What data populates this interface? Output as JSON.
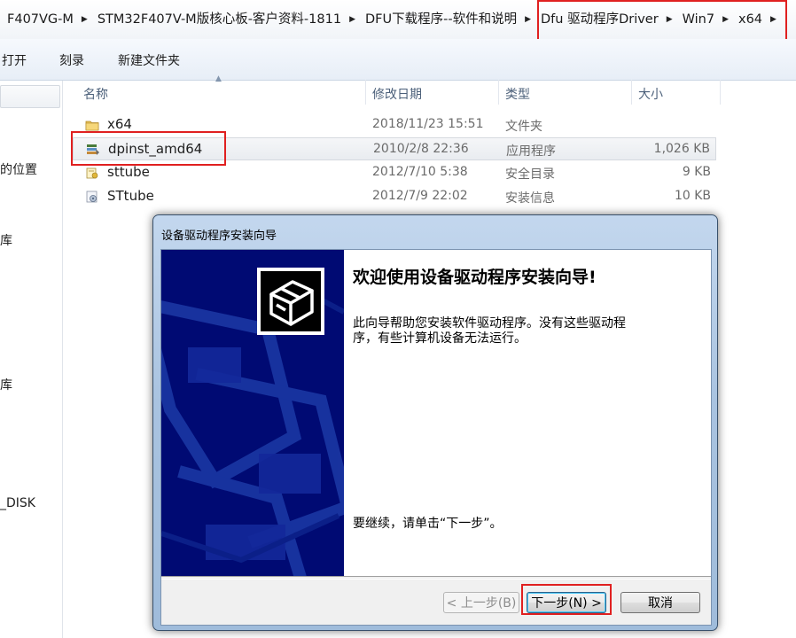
{
  "breadcrumb": {
    "items": [
      "F407VG-M",
      "STM32F407V-M版核心板-客户资料-1811",
      "DFU下载程序--软件和说明",
      "Dfu 驱动程序Driver",
      "Win7",
      "x64"
    ]
  },
  "toolbar": {
    "open_label": "打开",
    "burn_label": "刻录",
    "new_folder_label": "新建文件夹"
  },
  "nav": {
    "partial_items": [
      "的位置",
      "库",
      "库",
      "_DISK"
    ]
  },
  "columns": {
    "name": "名称",
    "date": "修改日期",
    "type": "类型",
    "size": "大小"
  },
  "files": [
    {
      "name": "x64",
      "date": "2018/11/23 15:51",
      "type": "文件夹",
      "size": "",
      "icon": "folder-icon"
    },
    {
      "name": "dpinst_amd64",
      "date": "2010/2/8 22:36",
      "type": "应用程序",
      "size": "1,026 KB",
      "icon": "installer-app-icon",
      "selected": true
    },
    {
      "name": "sttube",
      "date": "2012/7/10 5:38",
      "type": "安全目录",
      "size": "9 KB",
      "icon": "security-catalog-icon"
    },
    {
      "name": "STtube",
      "date": "2012/7/9 22:02",
      "type": "安装信息",
      "size": "10 KB",
      "icon": "setup-info-icon"
    }
  ],
  "dialog": {
    "title": "设备驱动程序安装向导",
    "heading": "欢迎使用设备驱动程序安装向导!",
    "description_line1": "此向导帮助您安装软件驱动程序。没有这些驱动程",
    "description_line2": "序，有些计算机设备无法运行。",
    "continue_text": "要继续，请单击“下一步”。",
    "back_label": "< 上一步(B)",
    "next_label": "下一步(N) >",
    "cancel_label": "取消"
  },
  "colors": {
    "annotation_red": "#e02020",
    "banner_blue": "#000a73",
    "selection_gray": "#e9ecf0"
  }
}
